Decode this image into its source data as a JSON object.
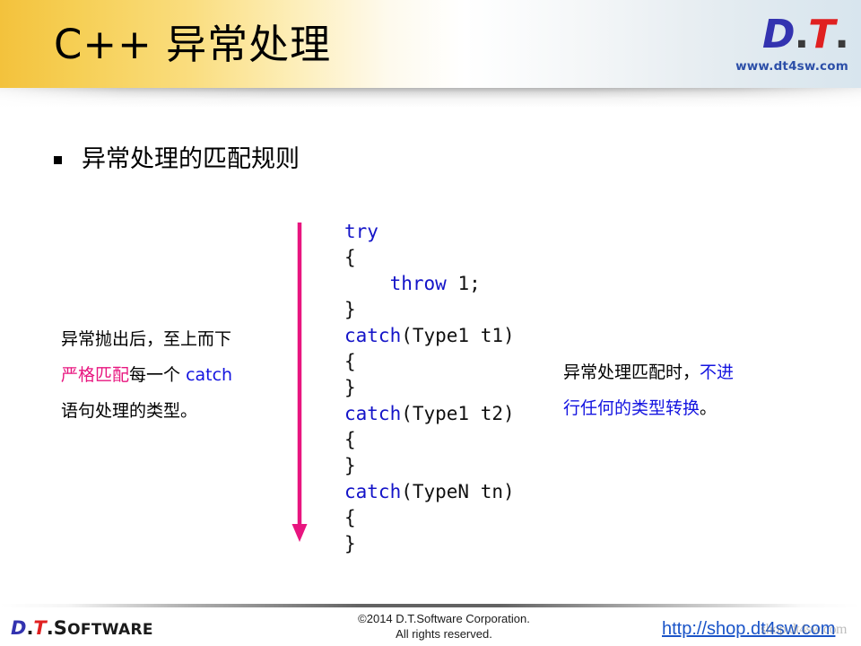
{
  "header": {
    "title": "C++ 异常处理",
    "logo": {
      "d": "D",
      "dot1": ".",
      "t": "T",
      "dot2": ".",
      "url": "www.dt4sw.com"
    }
  },
  "bullet": {
    "marker": "square-bullet",
    "text": "异常处理的匹配规则"
  },
  "code": {
    "lines": [
      {
        "indent": "",
        "kw": "try",
        "rest": ""
      },
      {
        "indent": "",
        "kw": "",
        "rest": "{"
      },
      {
        "indent": "    ",
        "kw": "throw",
        "rest": " 1;"
      },
      {
        "indent": "",
        "kw": "",
        "rest": "}"
      },
      {
        "indent": "",
        "kw": "catch",
        "rest": "(Type1 t1)"
      },
      {
        "indent": "",
        "kw": "",
        "rest": "{"
      },
      {
        "indent": "",
        "kw": "",
        "rest": "}"
      },
      {
        "indent": "",
        "kw": "catch",
        "rest": "(Type1 t2)"
      },
      {
        "indent": "",
        "kw": "",
        "rest": "{"
      },
      {
        "indent": "",
        "kw": "",
        "rest": "}"
      },
      {
        "indent": "",
        "kw": "catch",
        "rest": "(TypeN tn)"
      },
      {
        "indent": "",
        "kw": "",
        "rest": "{"
      },
      {
        "indent": "",
        "kw": "",
        "rest": "}"
      }
    ],
    "keyword_color": "#1414c8",
    "plain_color": "#101010"
  },
  "arrow": {
    "name": "downward-flow-arrow",
    "color": "#e8157f",
    "direction": "down"
  },
  "note_left": {
    "line1": "异常抛出后，至上而下",
    "line2_a": "严格匹配",
    "line2_b": "每一个 ",
    "line2_c": "catch",
    "line3": "语句处理的类型。",
    "highlight_color": "#e8157f",
    "keyword_color": "#1414e0"
  },
  "note_right": {
    "line1_a": "异常处理匹配时，",
    "line1_b": "不进",
    "line2_a": "行任何的类型转换",
    "line2_b": "。",
    "highlight_color": "#1414e0"
  },
  "footer": {
    "logo": {
      "d": "D",
      "dot1": ".",
      "t": "T",
      "dot2": ".",
      "word_cap": "S",
      "word_rest": "OFTWARE"
    },
    "copyright_line1": "©2014 D.T.Software Corporation.",
    "copyright_line2": "All rights reserved.",
    "link": "http://shop.dt4sw.com",
    "watermark": "shop.dt4sw.com"
  }
}
